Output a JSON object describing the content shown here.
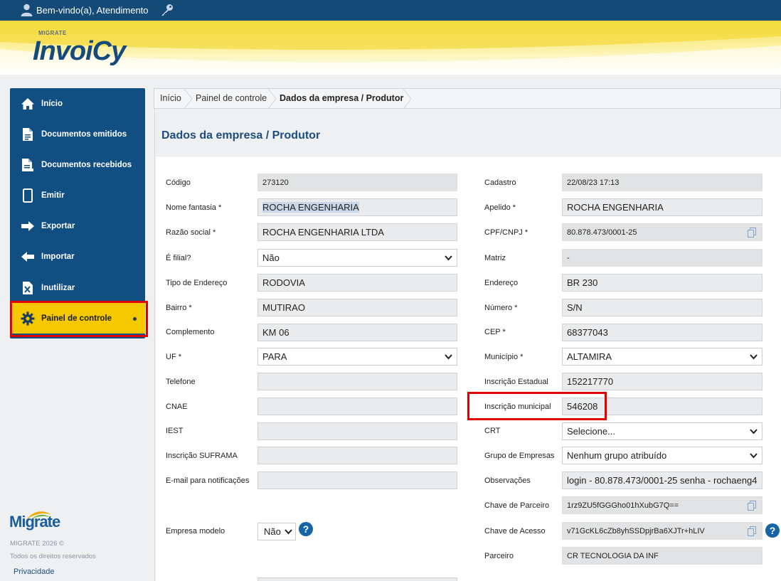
{
  "topbar": {
    "welcome": "Bem-vindo(a), Atendimento"
  },
  "logo": {
    "small": "MIGRATE",
    "main": "InvoiCy"
  },
  "sidebar": {
    "items": [
      {
        "label": "Início",
        "icon": "home-icon"
      },
      {
        "label": "Documentos emitidos",
        "icon": "document-out-icon"
      },
      {
        "label": "Documentos recebidos",
        "icon": "document-in-icon"
      },
      {
        "label": "Emitir",
        "icon": "mobile-icon"
      },
      {
        "label": "Exportar",
        "icon": "arrow-right-icon"
      },
      {
        "label": "Importar",
        "icon": "arrow-left-icon"
      },
      {
        "label": "Inutilizar",
        "icon": "document-x-icon"
      },
      {
        "label": "Painel de controle",
        "icon": "gear-icon",
        "active": true
      }
    ],
    "footer": {
      "brand": "Migrate",
      "copy": "MIGRATE 2026 ©",
      "rights": "Todos os direitos reservados",
      "privacy": "Privacidade"
    }
  },
  "breadcrumb": [
    "Início",
    "Painel de controle",
    "Dados da empresa / Produtor"
  ],
  "page_title": "Dados da empresa / Produtor",
  "form": {
    "left": {
      "codigo": {
        "label": "Código",
        "value": "273120"
      },
      "nome_fantasia": {
        "label": "Nome fantasia *",
        "value": "ROCHA ENGENHARIA"
      },
      "razao_social": {
        "label": "Razão social *",
        "value": "ROCHA ENGENHARIA LTDA"
      },
      "filial": {
        "label": "É filial?",
        "value": "Não"
      },
      "tipo_endereco": {
        "label": "Tipo de Endereço",
        "value": "RODOVIA"
      },
      "bairro": {
        "label": "Bairro *",
        "value": "MUTIRAO"
      },
      "complemento": {
        "label": "Complemento",
        "value": "KM 06"
      },
      "uf": {
        "label": "UF *",
        "value": "PARA"
      },
      "telefone": {
        "label": "Telefone",
        "value": ""
      },
      "cnae": {
        "label": "CNAE",
        "value": ""
      },
      "iest": {
        "label": "IEST",
        "value": ""
      },
      "suframa": {
        "label": "Inscrição SUFRAMA",
        "value": ""
      },
      "email": {
        "label": "E-mail para notificações",
        "value": ""
      },
      "empresa_modelo": {
        "label": "Empresa modelo",
        "value": "Não"
      }
    },
    "right": {
      "cadastro": {
        "label": "Cadastro",
        "value": "22/08/23 17:13"
      },
      "apelido": {
        "label": "Apelido *",
        "value": "ROCHA ENGENHARIA"
      },
      "cpf_cnpj": {
        "label": "CPF/CNPJ *",
        "value": "80.878.473/0001-25"
      },
      "matriz": {
        "label": "Matriz",
        "value": "-"
      },
      "endereco": {
        "label": "Endereço",
        "value": "BR 230"
      },
      "numero": {
        "label": "Número *",
        "value": "S/N"
      },
      "cep": {
        "label": "CEP *",
        "value": "68377043"
      },
      "municipio": {
        "label": "Município *",
        "value": "ALTAMIRA"
      },
      "inscricao_estadual": {
        "label": "Inscrição Estadual",
        "value": "152217770"
      },
      "inscricao_municipal": {
        "label": "Inscrição municipal",
        "value": "546208"
      },
      "crt": {
        "label": "CRT",
        "value": "Selecione..."
      },
      "grupo_empresas": {
        "label": "Grupo de Empresas",
        "value": "Nenhum grupo atribuído"
      },
      "observacoes": {
        "label": "Observações",
        "value": "login - 80.878.473/0001-25 senha - rochaeng4"
      },
      "chave_parceiro": {
        "label": "Chave de Parceiro",
        "value": "1rz9ZU5fGGGho01hXubG7Q=="
      },
      "chave_acesso": {
        "label": "Chave de Acesso",
        "value": "v71GcKL6cZb8yhSSDpjrBa6XJTr+hLIV"
      },
      "parceiro": {
        "label": "Parceiro",
        "value": "CR TECNOLOGIA DA INF"
      }
    }
  },
  "colors": {
    "primary": "#134a78",
    "accent": "#f5c800",
    "highlight": "#e00000"
  }
}
